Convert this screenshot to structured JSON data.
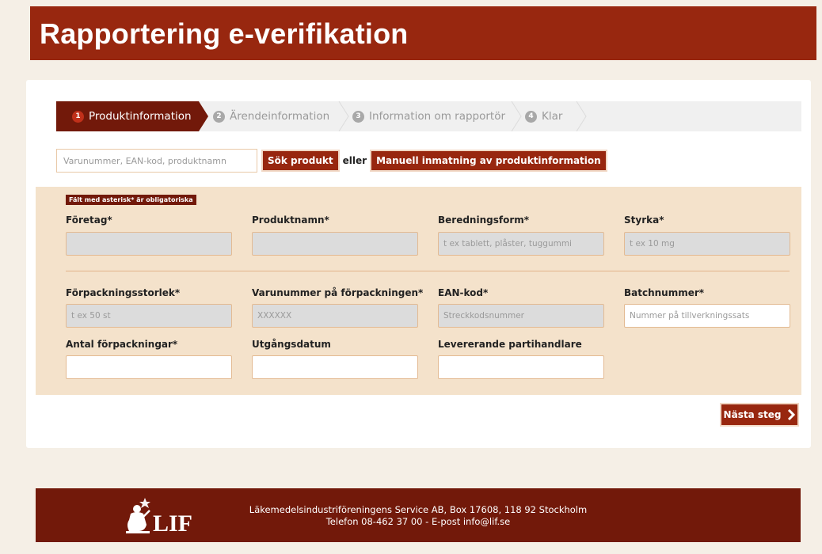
{
  "header": {
    "title": "Rapportering e-verifikation"
  },
  "steps": [
    {
      "num": "1",
      "label": "Produktinformation"
    },
    {
      "num": "2",
      "label": "Ärendeinformation"
    },
    {
      "num": "3",
      "label": "Information om rapportör"
    },
    {
      "num": "4",
      "label": "Klar"
    }
  ],
  "search": {
    "placeholder": "Varunummer, EAN-kod, produktnamn",
    "button": "Sök produkt",
    "or": "eller",
    "manual_button": "Manuell inmatning av produktinformation"
  },
  "form": {
    "required_note": "Fält med asterisk* är obligatoriska",
    "fields": {
      "company": {
        "label": "Företag*",
        "placeholder": ""
      },
      "product_name": {
        "label": "Produktnamn*",
        "placeholder": ""
      },
      "form": {
        "label": "Beredningsform*",
        "placeholder": "t ex tablett, plåster, tuggummi"
      },
      "strength": {
        "label": "Styrka*",
        "placeholder": "t ex 10 mg"
      },
      "pack_size": {
        "label": "Förpackningsstorlek*",
        "placeholder": "t ex 50 st"
      },
      "item_number": {
        "label": "Varunummer på förpackningen*",
        "placeholder": "XXXXXX"
      },
      "ean": {
        "label": "EAN-kod*",
        "placeholder": "Streckkodsnummer"
      },
      "batch": {
        "label": "Batchnummer*",
        "placeholder": "Nummer på tillverkningssats"
      },
      "quantity": {
        "label": "Antal förpackningar*",
        "placeholder": ""
      },
      "expiry": {
        "label": "Utgångsdatum",
        "placeholder": ""
      },
      "wholesaler": {
        "label": "Levererande partihandlare",
        "placeholder": ""
      }
    }
  },
  "next_button": "Nästa steg",
  "footer": {
    "logo_text": "LIF",
    "line1": "Läkemedelsindustriföreningens Service AB, Box 17608, 118 92 Stockholm",
    "line2": "Telefon 08-462 37 00 - E-post info@lif.se"
  },
  "colors": {
    "brand": "#98270f",
    "dark_brand": "#72190a",
    "panel": "#f4e2cb",
    "page_bg": "#f5efe6"
  }
}
